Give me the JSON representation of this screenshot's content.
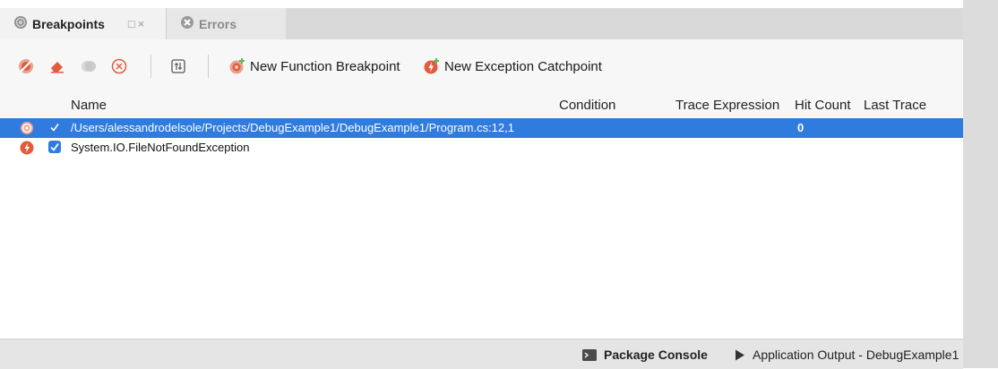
{
  "tabs": {
    "active": {
      "label": "Breakpoints",
      "controls": "□×"
    },
    "inactive": {
      "label": "Errors"
    }
  },
  "toolbar": {
    "icons": [
      "breakpoint-toggle-icon",
      "eraser-icon",
      "disable-all-icon",
      "remove-icon",
      "properties-icon"
    ],
    "new_function_breakpoint": "New Function Breakpoint",
    "new_exception_catchpoint": "New Exception Catchpoint"
  },
  "table": {
    "columns": {
      "name": "Name",
      "condition": "Condition",
      "trace_expression": "Trace Expression",
      "hit_count": "Hit Count",
      "last_trace": "Last Trace"
    },
    "rows": [
      {
        "name": "/Users/alessandrodelsole/Projects/DebugExample1/DebugExample1/Program.cs:12,1",
        "hit_count": "0",
        "selected": true
      },
      {
        "name": "System.IO.FileNotFoundException",
        "hit_count": "",
        "selected": false
      }
    ]
  },
  "statusbar": {
    "package_console": "Package Console",
    "application_output": "Application Output - DebugExample1"
  },
  "colors": {
    "selection": "#2f7bde",
    "breakpoint_red": "#e25b3c"
  }
}
